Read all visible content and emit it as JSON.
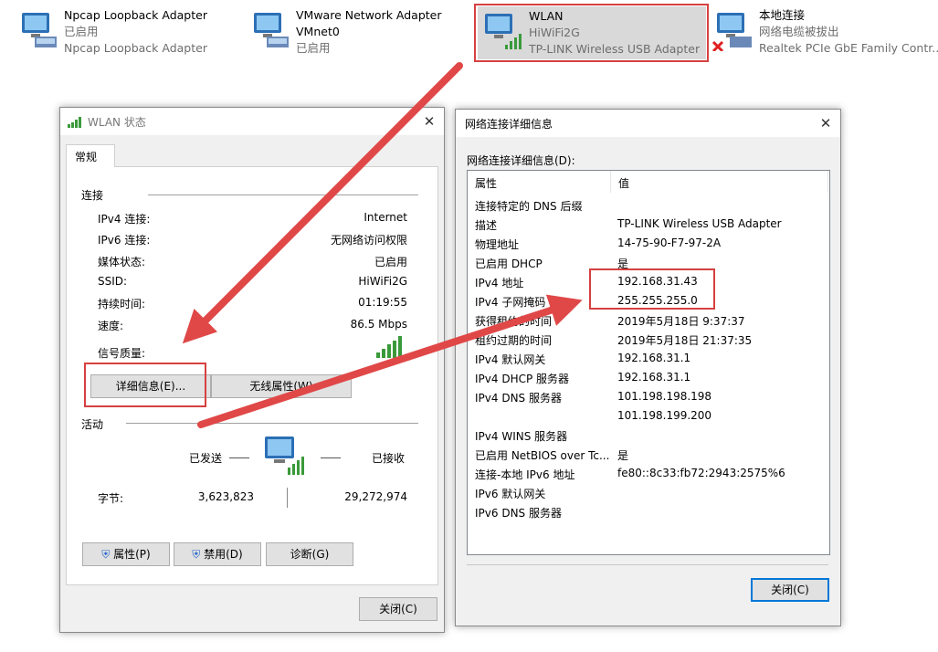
{
  "adapters": [
    {
      "name": "Npcap Loopback Adapter",
      "status": "已启用",
      "device": "Npcap Loopback Adapter",
      "icon": "network-adapter-icon"
    },
    {
      "name": "VMware Network Adapter VMnet0",
      "name_line2": "VMnet0",
      "name_line1": "VMware Network Adapter",
      "status": "已启用",
      "icon": "network-adapter-icon"
    },
    {
      "name": "WLAN",
      "status": "HiWiFi2G",
      "device": "TP-LINK Wireless USB Adapter",
      "icon": "wireless-adapter-icon"
    },
    {
      "name": "本地连接",
      "status": "网络电缆被拔出",
      "device": "Realtek PCIe GbE Family Contr...",
      "icon": "network-adapter-disconnected-icon"
    }
  ],
  "status_dialog": {
    "title": "WLAN 状态",
    "tab": "常规",
    "section_connection": "连接",
    "rows": [
      {
        "label": "IPv4 连接:",
        "value": "Internet"
      },
      {
        "label": "IPv6 连接:",
        "value": "无网络访问权限"
      },
      {
        "label": "媒体状态:",
        "value": "已启用"
      },
      {
        "label": "SSID:",
        "value": "HiWiFi2G"
      },
      {
        "label": "持续时间:",
        "value": "01:19:55"
      },
      {
        "label": "速度:",
        "value": "86.5 Mbps"
      }
    ],
    "signal_label": "信号质量:",
    "details_button": "详细信息(E)...",
    "wireless_button": "无线属性(W)",
    "section_activity": "活动",
    "sent_label": "已发送",
    "received_label": "已接收",
    "bytes_label": "字节:",
    "bytes_sent": "3,623,823",
    "bytes_received": "29,272,974",
    "properties_button": "属性(P)",
    "disable_button": "禁用(D)",
    "diagnose_button": "诊断(G)",
    "close_button": "关闭(C)"
  },
  "details_dialog": {
    "title": "网络连接详细信息",
    "caption": "网络连接详细信息(D):",
    "col_property": "属性",
    "col_value": "值",
    "rows": [
      {
        "p": "连接特定的 DNS 后缀",
        "v": ""
      },
      {
        "p": "描述",
        "v": "TP-LINK Wireless USB Adapter"
      },
      {
        "p": "物理地址",
        "v": "14-75-90-F7-97-2A"
      },
      {
        "p": "已启用 DHCP",
        "v": "是"
      },
      {
        "p": "IPv4 地址",
        "v": "192.168.31.43"
      },
      {
        "p": "IPv4 子网掩码",
        "v": "255.255.255.0"
      },
      {
        "p": "获得租约的时间",
        "v": "2019年5月18日 9:37:37"
      },
      {
        "p": "租约过期的时间",
        "v": "2019年5月18日 21:37:35"
      },
      {
        "p": "IPv4 默认网关",
        "v": "192.168.31.1"
      },
      {
        "p": "IPv4 DHCP 服务器",
        "v": "192.168.31.1"
      },
      {
        "p": "IPv4 DNS 服务器",
        "v": "101.198.198.198"
      },
      {
        "p": "",
        "v": "101.198.199.200"
      },
      {
        "p": "IPv4 WINS 服务器",
        "v": ""
      },
      {
        "p": "已启用 NetBIOS over Tc...",
        "v": "是"
      },
      {
        "p": "连接-本地 IPv6 地址",
        "v": "fe80::8c33:fb72:2943:2575%6"
      },
      {
        "p": "IPv6 默认网关",
        "v": ""
      },
      {
        "p": "IPv6 DNS 服务器",
        "v": ""
      }
    ],
    "close_button": "关闭(C)"
  },
  "colors": {
    "highlight_red": "#d64040",
    "focus_blue": "#0078d7",
    "signal_green": "#3a9a3a"
  }
}
